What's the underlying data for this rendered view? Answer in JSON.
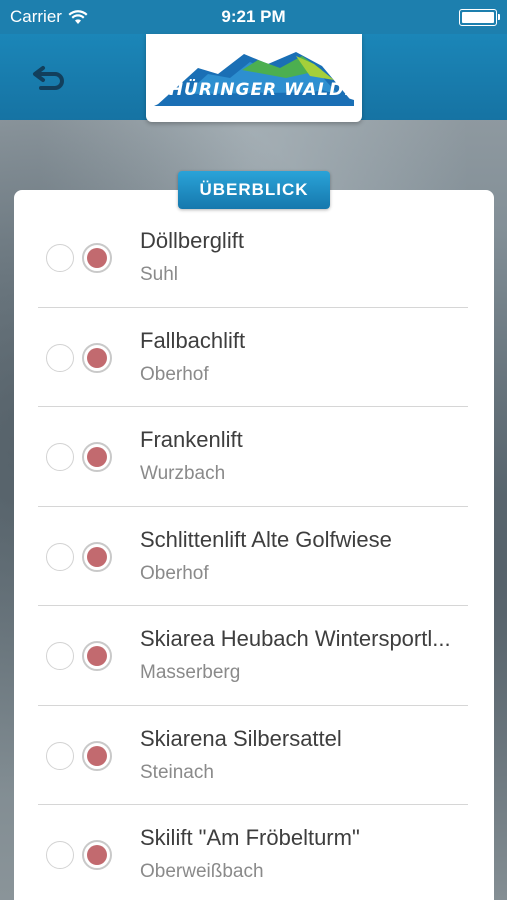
{
  "status_bar": {
    "carrier": "Carrier",
    "time": "9:21 PM"
  },
  "nav": {
    "logo_text": "THÜRINGER WALD."
  },
  "section": {
    "title": "ÜBERBLICK"
  },
  "colors": {
    "accent": "#1b86b8",
    "selected_dot": "#c26a6f"
  },
  "lifts": [
    {
      "name": "Döllberglift",
      "place": "Suhl"
    },
    {
      "name": "Fallbachlift",
      "place": "Oberhof"
    },
    {
      "name": "Frankenlift",
      "place": "Wurzbach"
    },
    {
      "name": "Schlittenlift Alte Golfwiese",
      "place": "Oberhof"
    },
    {
      "name": "Skiarea Heubach Wintersportl...",
      "place": "Masserberg"
    },
    {
      "name": "Skiarena Silbersattel",
      "place": "Steinach"
    },
    {
      "name": "Skilift \"Am Fröbelturm\"",
      "place": "Oberweißbach"
    }
  ]
}
